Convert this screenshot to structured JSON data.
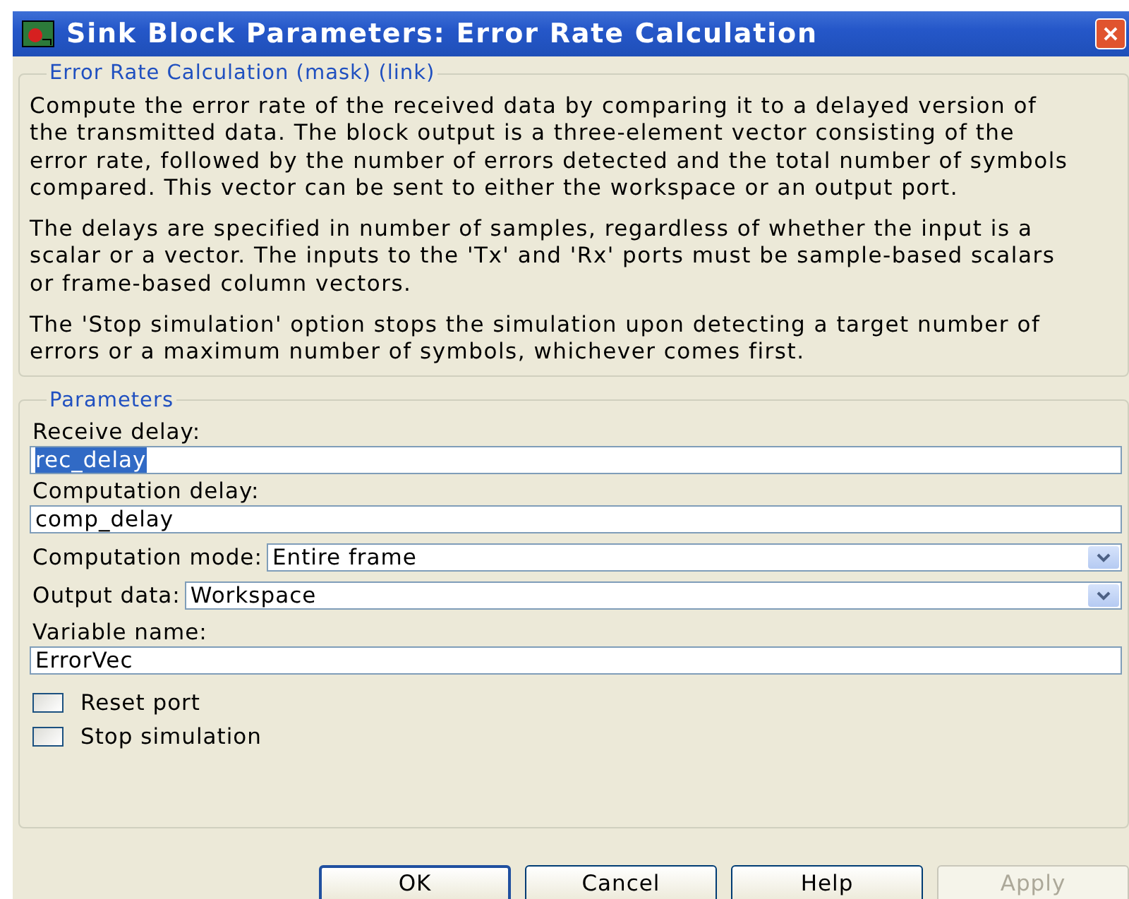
{
  "window": {
    "title": "Sink Block Parameters: Error Rate Calculation"
  },
  "description": {
    "legend": "Error Rate Calculation (mask) (link)",
    "paragraphs": [
      [
        "Compute the error rate of the received data by comparing it to a delayed version of",
        "the transmitted data. The block output is a three-element vector consisting of the",
        "error rate, followed by the number of errors detected and the total number of symbols",
        "compared. This vector can be sent to either the workspace or an output port."
      ],
      [
        "The delays are specified in number of samples, regardless of whether the input is a",
        "scalar or a vector. The inputs to the 'Tx' and 'Rx' ports must be sample-based scalars",
        "or frame-based column vectors."
      ],
      [
        "The 'Stop simulation' option stops the simulation upon detecting a target number of",
        "errors or a maximum number of symbols, whichever comes first."
      ]
    ]
  },
  "parameters": {
    "legend": "Parameters",
    "fields": [
      {
        "kind": "text",
        "label": "Receive delay:",
        "value": "rec_delay",
        "text_selected": true
      },
      {
        "kind": "text",
        "label": "Computation delay:",
        "value": "comp_delay",
        "text_selected": false
      },
      {
        "kind": "dropdown",
        "label": "Computation mode:",
        "value": "Entire frame"
      },
      {
        "kind": "dropdown",
        "label": "Output data:",
        "value": "Workspace"
      },
      {
        "kind": "text",
        "label": "Variable name:",
        "value": "ErrorVec",
        "text_selected": false
      }
    ],
    "checkboxes": [
      {
        "label": "Reset port",
        "checked": false
      },
      {
        "label": "Stop simulation",
        "checked": false
      }
    ]
  },
  "buttons": [
    {
      "label": "OK",
      "default": true,
      "disabled": false
    },
    {
      "label": "Cancel",
      "default": false,
      "disabled": false
    },
    {
      "label": "Help",
      "default": false,
      "disabled": false
    },
    {
      "label": "Apply",
      "default": false,
      "disabled": true
    }
  ]
}
